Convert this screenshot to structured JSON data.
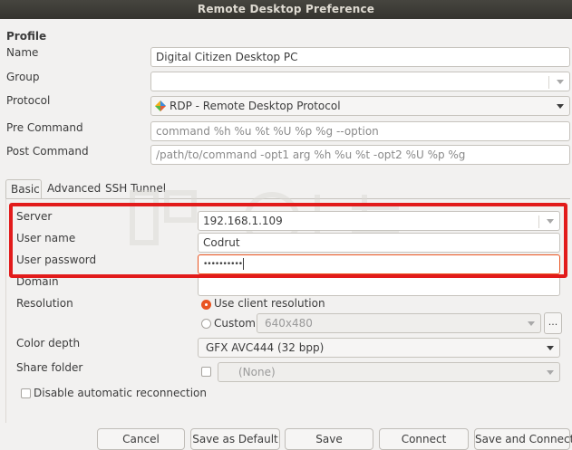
{
  "window": {
    "title": "Remote Desktop Preference"
  },
  "profile": {
    "section_title": "Profile",
    "name": {
      "label": "Name",
      "value": "Digital Citizen Desktop PC"
    },
    "group": {
      "label": "Group",
      "value": ""
    },
    "protocol": {
      "label": "Protocol",
      "value": "RDP - Remote Desktop Protocol",
      "icon": "rdp-protocol-icon"
    },
    "pre_command": {
      "label": "Pre Command",
      "placeholder": "command %h %u %t %U %p %g --option"
    },
    "post_command": {
      "label": "Post Command",
      "placeholder": "/path/to/command -opt1 arg %h %u %t -opt2 %U %p %g"
    }
  },
  "tabs": [
    "Basic",
    "Advanced",
    "SSH Tunnel"
  ],
  "basic": {
    "server": {
      "label": "Server",
      "value": "192.168.1.109"
    },
    "username": {
      "label": "User name",
      "value": "Codrut"
    },
    "password": {
      "label": "User password",
      "masked": "••••••••••"
    },
    "domain": {
      "label": "Domain",
      "value": ""
    },
    "resolution": {
      "label": "Resolution",
      "option_client": "Use client resolution",
      "option_custom": "Custom",
      "custom_value": "640x480",
      "more_label": "...",
      "selected": "client"
    },
    "color_depth": {
      "label": "Color depth",
      "value": "GFX AVC444 (32 bpp)"
    },
    "share_folder": {
      "label": "Share folder",
      "value": "(None)"
    },
    "disable_reconnect": {
      "label": "Disable automatic reconnection",
      "checked": false
    }
  },
  "buttons": {
    "cancel": "Cancel",
    "save_default": "Save as Default",
    "save": "Save",
    "connect": "Connect",
    "save_connect": "Save and Connect"
  },
  "colors": {
    "accent": "#e95420",
    "highlight": "#e21b1b",
    "titlebar": "#3c3b37"
  }
}
